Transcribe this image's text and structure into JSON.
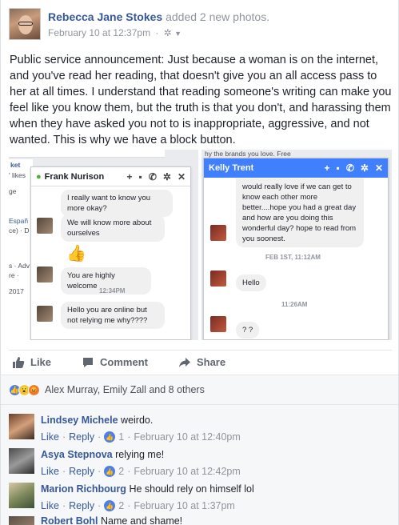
{
  "post": {
    "author": "Rebecca Jane Stokes",
    "action": " added 2 new photos.",
    "timestamp": "February 10 at 12:37pm",
    "privacy_icon": "gear-icon",
    "text": "Public service announcement: Just because a woman is on the internet, and you've read her reading, that doesn't give you an all access pass to her at all times. I understand that reading someone's writing can make you feel like you know them, but the truth is that you don't, and harassing them when they have asked you not to is inappropriate, aggressive, and not wanted. This is why we have a block button."
  },
  "photo1": {
    "bg_fragments": [
      "ket",
      "' likes",
      "ge",
      "Españ",
      "ce) · D",
      "s · Adv",
      "re ·",
      "2017"
    ],
    "chat_name": "Frank Nurison",
    "messages": [
      "I really want to know you more okay?",
      "We will know more about ourselves",
      "You are highly welcome",
      "Hello you are online but not relying me why????"
    ],
    "emoji": "👍",
    "time": "12:34PM"
  },
  "photo2": {
    "bg_fragment": "hy the brands you love. Free",
    "chat_name": "Kelly Trent",
    "header_color": "#4080ff",
    "messages": [
      "would really love if we can get to know each other more better....hope you had a great day and how are you doing this wonderful day? hope to read from you soonest.",
      "Hello",
      "? ?"
    ],
    "time1": "FEB 1ST, 11:12AM",
    "time2": "11:26AM"
  },
  "actions": {
    "like": "Like",
    "comment": "Comment",
    "share": "Share"
  },
  "reactions": {
    "names": "Alex Murray, Emily Zall and 8 others"
  },
  "comments": [
    {
      "name": "Lindsey Michele",
      "text": "weirdo.",
      "likes": "1",
      "date": "February 10 at 12:40pm"
    },
    {
      "name": "Asya Stepnova",
      "text": "relying me!",
      "likes": "2",
      "date": "February 10 at 12:42pm"
    },
    {
      "name": "Marion Richbourg",
      "text": "He should rely on himself lol",
      "likes": "2",
      "date": "February 10 at 1:37pm"
    },
    {
      "name": "Robert Bohl",
      "text": "Name and shame!"
    }
  ],
  "comment_labels": {
    "like": "Like",
    "reply": "Reply"
  },
  "colors": {
    "link": "#365899",
    "meta": "#90949c",
    "messenger_blue": "#4080ff"
  }
}
